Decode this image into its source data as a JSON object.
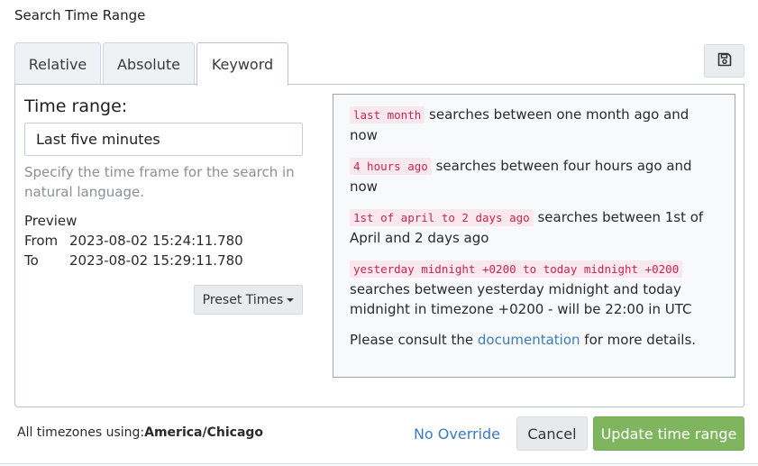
{
  "modal": {
    "title": "Search Time Range"
  },
  "tabs": [
    {
      "label": "Relative",
      "active": false
    },
    {
      "label": "Absolute",
      "active": false
    },
    {
      "label": "Keyword",
      "active": true
    }
  ],
  "toolbar": {
    "save_icon": "floppy-disk-icon"
  },
  "keyword": {
    "label": "Time range:",
    "value": "Last five minutes",
    "help": "Specify the time frame for the search in natural language.",
    "preview": {
      "title": "Preview",
      "from_label": "From",
      "from_value": "2023-08-02 15:24:11.780",
      "to_label": "To",
      "to_value": "2023-08-02 15:29:11.780"
    },
    "preset_label": "Preset Times"
  },
  "examples": [
    {
      "code": "last month",
      "text": "searches between one month ago and now"
    },
    {
      "code": "4 hours ago",
      "text": "searches between four hours ago and now"
    },
    {
      "code": "1st of april to 2 days ago",
      "text": "searches between 1st of April and 2 days ago"
    },
    {
      "code": "yesterday midnight +0200 to today midnight +0200",
      "text": "searches between yesterday midnight and today midnight in timezone +0200 - will be 22:00 in UTC"
    }
  ],
  "consult": {
    "before": "Please consult the ",
    "link": "documentation",
    "after": " for more details."
  },
  "footer": {
    "tz_prefix": "All timezones using:",
    "tz_value": "America/Chicago",
    "no_override": "No Override",
    "cancel": "Cancel",
    "update": "Update time range"
  },
  "colors": {
    "primary": "#80b55f",
    "link": "#3a7bbf",
    "code": "#c7254e"
  }
}
